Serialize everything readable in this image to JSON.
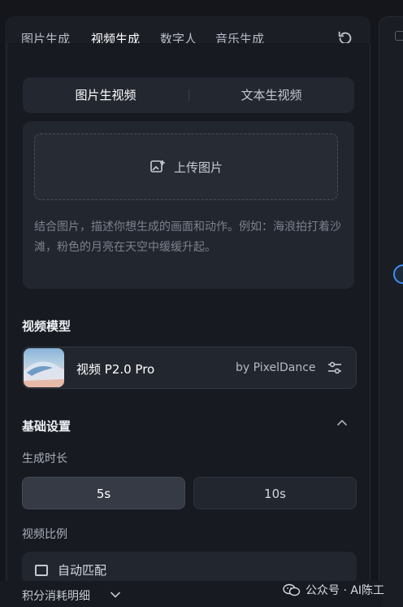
{
  "tabs": [
    {
      "label": "图片生成",
      "active": false
    },
    {
      "label": "视频生成",
      "active": true
    },
    {
      "label": "数字人",
      "active": false
    },
    {
      "label": "音乐生成",
      "active": false
    }
  ],
  "mode_switch": {
    "left": "图片生视频",
    "right": "文本生视频",
    "selected": "left"
  },
  "upload": {
    "label": "上传图片",
    "hint": "结合图片，描述你想生成的画面和动作。例如：海浪拍打着沙滩，粉色的月亮在天空中缓缓升起。"
  },
  "model": {
    "section_title": "视频模型",
    "name": "视频 P2.0 Pro",
    "by": "by PixelDance"
  },
  "basic": {
    "section_title": "基础设置",
    "duration_label": "生成时长",
    "durations": [
      "5s",
      "10s"
    ],
    "selected_duration": "5s",
    "ratio_label": "视频比例",
    "ratio_value": "自动匹配"
  },
  "footer": {
    "label": "积分消耗明细"
  },
  "watermark": {
    "text": "公众号 · AI陈工"
  },
  "colors": {
    "accent": "#3f8ef5",
    "panel": "#1b1e25"
  }
}
